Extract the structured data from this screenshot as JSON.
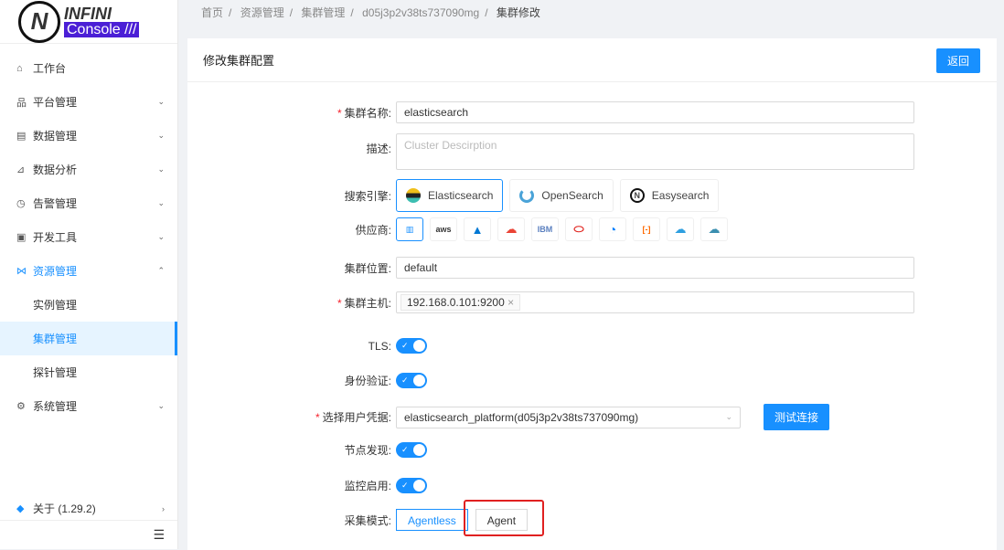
{
  "logo": {
    "line1": "INFINI",
    "line2": "Console ///"
  },
  "sidebar": {
    "items": [
      {
        "label": "工作台",
        "icon": "home-icon"
      },
      {
        "label": "平台管理",
        "icon": "cluster-icon",
        "chevron": true
      },
      {
        "label": "数据管理",
        "icon": "database-icon",
        "chevron": true
      },
      {
        "label": "数据分析",
        "icon": "chart-icon",
        "chevron": true
      },
      {
        "label": "告警管理",
        "icon": "alarm-icon",
        "chevron": true
      },
      {
        "label": "开发工具",
        "icon": "terminal-icon",
        "chevron": true
      },
      {
        "label": "资源管理",
        "icon": "share-icon",
        "chevron": true
      },
      {
        "label": "实例管理"
      },
      {
        "label": "集群管理"
      },
      {
        "label": "探针管理"
      },
      {
        "label": "系统管理",
        "icon": "gear-icon",
        "chevron": true
      }
    ],
    "about": "关于 (1.29.2)"
  },
  "breadcrumb": [
    "首页",
    "资源管理",
    "集群管理",
    "d05j3p2v38ts737090mg",
    "集群修改"
  ],
  "card": {
    "title": "修改集群配置",
    "back": "返回"
  },
  "form": {
    "name_label": "集群名称:",
    "name_value": "elasticsearch",
    "desc_label": "描述:",
    "desc_placeholder": "Cluster Descirption",
    "engine_label": "搜索引擎:",
    "engines": [
      "Elasticsearch",
      "OpenSearch",
      "Easysearch"
    ],
    "provider_label": "供应商:",
    "providers": [
      "on-prem",
      "aws",
      "azure",
      "gcp",
      "IBM",
      "oracle",
      "digitalocean",
      "aliyun",
      "tencent",
      "huawei"
    ],
    "location_label": "集群位置:",
    "location_value": "default",
    "host_label": "集群主机:",
    "host_tag": "192.168.0.101:9200",
    "tls_label": "TLS:",
    "auth_label": "身份验证:",
    "cred_label": "选择用户凭据:",
    "cred_value": "elasticsearch_platform(d05j3p2v38ts737090mg)",
    "test_btn": "测试连接",
    "discovery_label": "节点发现:",
    "monitor_label": "监控启用:",
    "mode_label": "采集模式:",
    "modes": [
      "Agentless",
      "Agent"
    ]
  }
}
